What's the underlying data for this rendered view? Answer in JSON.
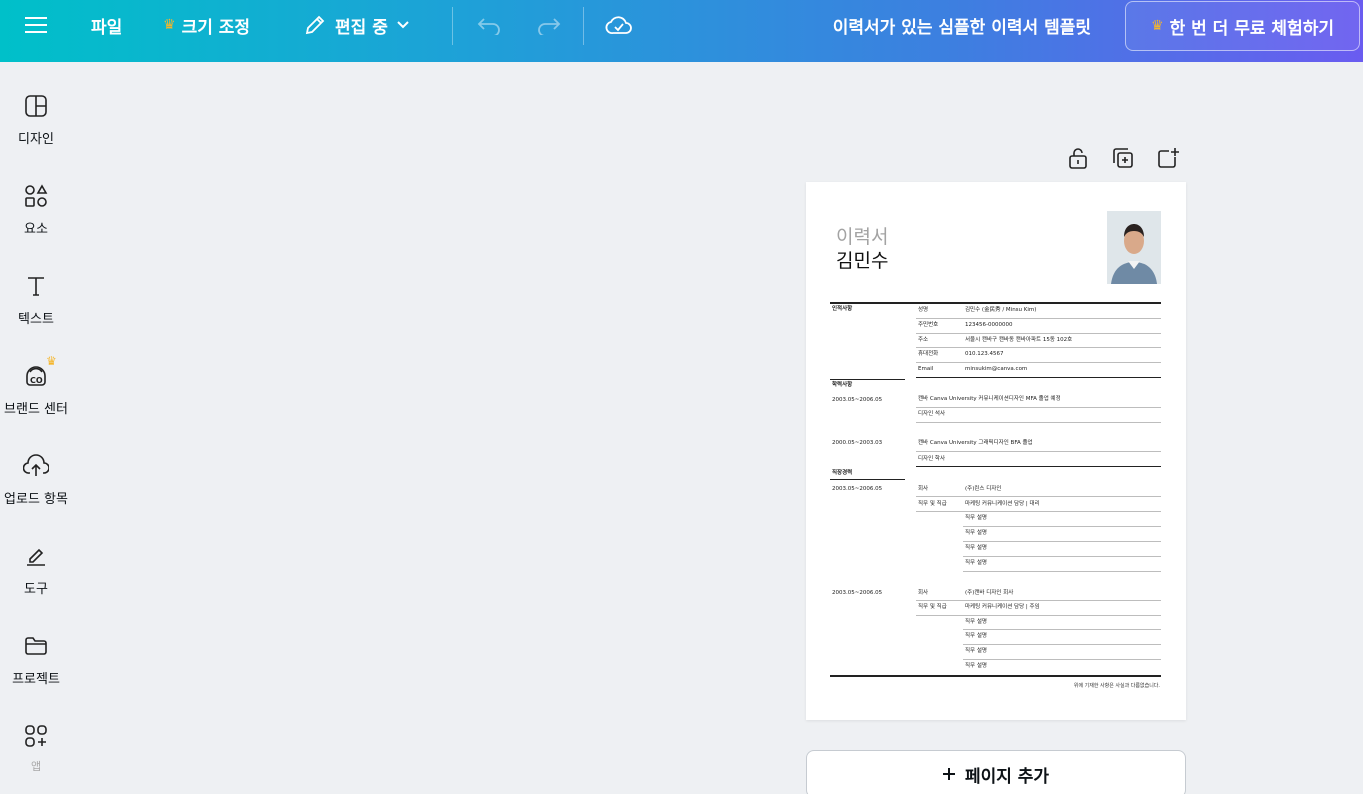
{
  "topbar": {
    "file_label": "파일",
    "resize_label": "크기 조정",
    "edit_label": "편집 중",
    "doc_title": "이력서가 있는 심플한 이력서 템플릿",
    "trial_label": "한 번 더 무료 체험하기",
    "icons": [
      "menu-icon",
      "crown-icon",
      "pencil-icon",
      "chevron-down-icon",
      "undo-icon",
      "redo-icon",
      "cloud-check-icon"
    ]
  },
  "sidebar": {
    "items": [
      {
        "label": "디자인",
        "icon": "design-icon"
      },
      {
        "label": "요소",
        "icon": "elements-icon"
      },
      {
        "label": "텍스트",
        "icon": "text-icon"
      },
      {
        "label": "브랜드 센터",
        "icon": "brand-icon"
      },
      {
        "label": "업로드 항목",
        "icon": "upload-icon"
      },
      {
        "label": "도구",
        "icon": "tools-icon"
      },
      {
        "label": "프로젝트",
        "icon": "folder-icon"
      },
      {
        "label": "앱",
        "icon": "apps-icon"
      }
    ]
  },
  "page_tools": [
    "unlock-icon",
    "duplicate-icon",
    "add-page-icon"
  ],
  "resume": {
    "label": "이력서",
    "name": "김민수",
    "personal": {
      "section": "인적사항",
      "rows": [
        {
          "k": "성명",
          "v": "김민수 (金民秀 / Minsu Kim)"
        },
        {
          "k": "주민번호",
          "v": "123456-0000000"
        },
        {
          "k": "주소",
          "v": "서울시 캔바구 캔바동 캔바아파트 15동 102호"
        },
        {
          "k": "휴대전화",
          "v": "010.123.4567"
        },
        {
          "k": "Email",
          "v": "minsukim@canva.com"
        }
      ]
    },
    "education": {
      "section": "학력사항",
      "entries": [
        {
          "date": "2003.05~2006.05",
          "lines": [
            "캔바 Canva University 커뮤니케이션디자인 MFA 졸업 예정",
            "디자인 석사"
          ]
        },
        {
          "date": "2000.05~2003.03",
          "lines": [
            "캔바 Canva University 그래픽디자인 BFA 졸업",
            "디자인 학사"
          ]
        }
      ]
    },
    "career": {
      "section": "직장경력",
      "entries": [
        {
          "date": "2003.05~2006.05",
          "company_k": "회사",
          "company_v": "(주)린스 디자인",
          "role_k": "직무 및 직급",
          "role_v": "마케팅 커뮤니케이션 담당 | 대리",
          "duties": [
            "직무 설명",
            "직무 설명",
            "직무 설명",
            "직무 설명"
          ]
        },
        {
          "date": "2003.05~2006.05",
          "company_k": "회사",
          "company_v": "(주)캔바 디자인 회사",
          "role_k": "직무 및 직급",
          "role_v": "마케팅 커뮤니케이션 담당 | 주임",
          "duties": [
            "직무 설명",
            "직무 설명",
            "직무 설명",
            "직무 설명"
          ]
        }
      ]
    },
    "footer": "위에 기재한 사항은 사실과 다름없습니다."
  },
  "add_page_label": "페이지 추가"
}
